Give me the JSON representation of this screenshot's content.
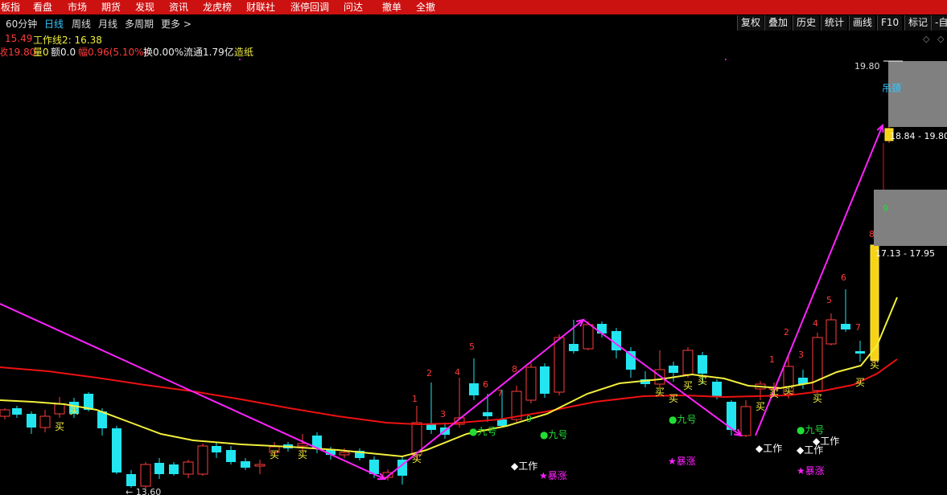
{
  "menu": [
    "板指",
    "看盘",
    "市场",
    "期货",
    "发现",
    "资讯",
    "龙虎榜",
    "财联社",
    "涨停回调",
    "问达",
    "撤单",
    "全撤"
  ],
  "periods": [
    {
      "label": "60分钟",
      "active": false
    },
    {
      "label": "日线",
      "active": true
    },
    {
      "label": "周线",
      "active": false
    },
    {
      "label": "月线",
      "active": false
    },
    {
      "label": "多周期",
      "active": false
    },
    {
      "label": "更多 >",
      "active": false
    }
  ],
  "tools": [
    "复权",
    "叠加",
    "历史",
    "统计",
    "画线",
    "F10",
    "标记",
    "-自"
  ],
  "info": {
    "line1_a": "15.49",
    "line1_b": "工作线2: 16.38",
    "close_label": "收19.80",
    "vol_label": "量0",
    "amt_label": "额0.0",
    "amp_label": "幅0.96(5.10%)",
    "turn_label": "换0.00%",
    "float_label": "流通1.79亿",
    "sign_label": "造纸"
  },
  "colors": {
    "up": "#ff3b3b",
    "down": "#22e5f0",
    "ma_red": "#ee1111",
    "ma_yellow": "#f2ef3c",
    "magenta": "#ff22ff",
    "green": "#22dd33",
    "menu_bg": "#cc1111"
  },
  "price_labels": {
    "top_price": "19.80",
    "low_price": "← 13.60",
    "limit_up": "吊颈",
    "range_high": "18.84 - 19.80",
    "range_low": "17.13 - 17.95",
    "nine": "9",
    "eight": "8"
  },
  "signals": {
    "buy": "买",
    "work": "◆工作",
    "surge": "★暴涨",
    "nine": "●九号"
  },
  "count_labels": [
    {
      "t": "1"
    },
    {
      "t": "2"
    },
    {
      "t": "3"
    },
    {
      "t": "4"
    },
    {
      "t": "5"
    },
    {
      "t": "6"
    },
    {
      "t": "7"
    },
    {
      "t": "8"
    },
    {
      "t": "9"
    },
    {
      "t": "1"
    },
    {
      "t": "2"
    },
    {
      "t": "3"
    },
    {
      "t": "4"
    },
    {
      "t": "5"
    },
    {
      "t": "6"
    },
    {
      "t": "7"
    }
  ]
}
